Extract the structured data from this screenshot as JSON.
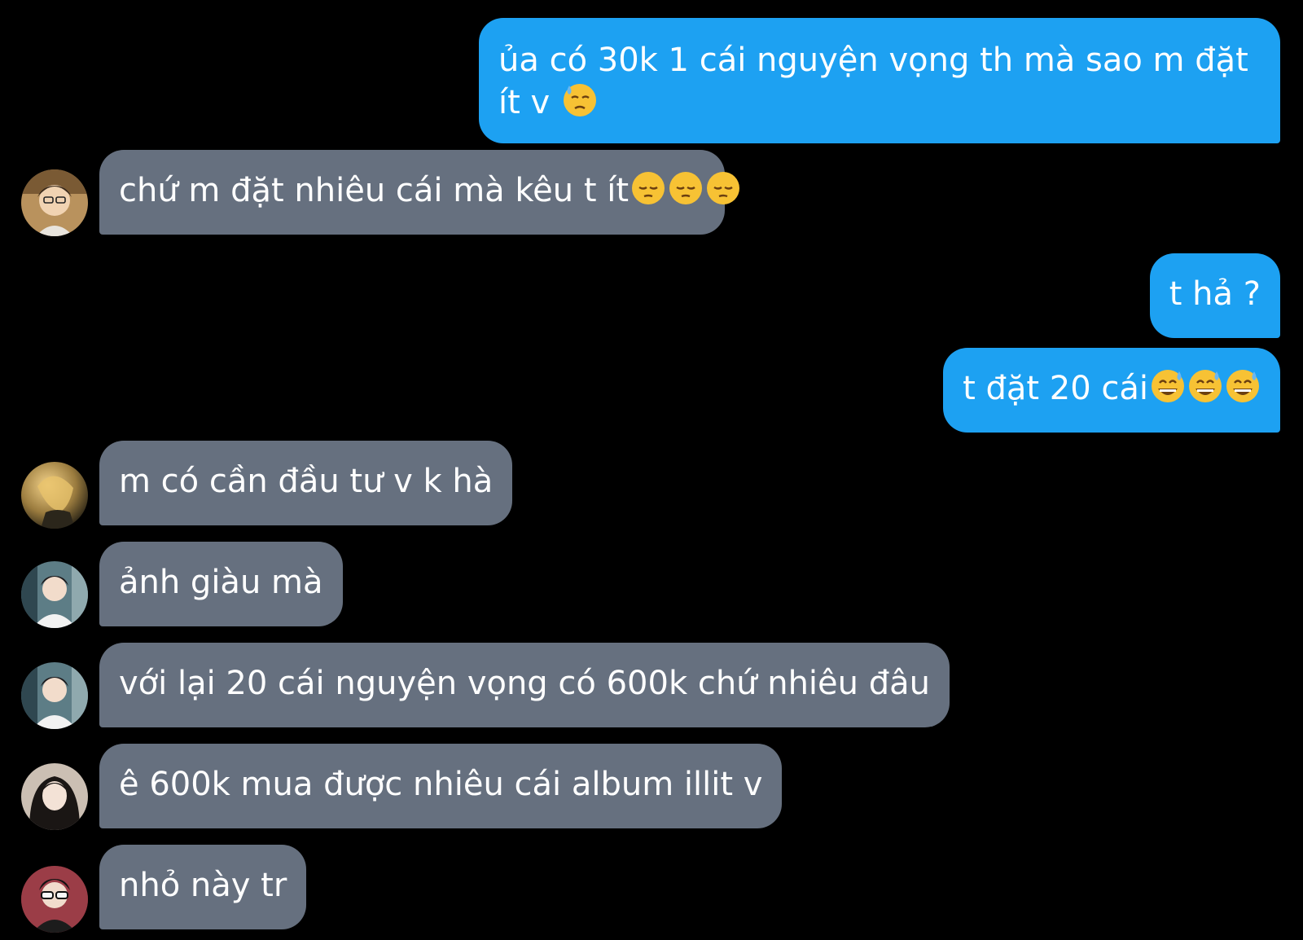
{
  "messages": [
    {
      "side": "sent",
      "text": "ủa có 30k 1 cái nguyện vọng th mà sao m đặt ít v",
      "emoji": [
        "downcast-sweat"
      ]
    },
    {
      "side": "received",
      "avatar": "avatar-1",
      "text": "chứ m đặt nhiêu cái mà kêu t ít",
      "emoji": [
        "pensive",
        "pensive",
        "pensive"
      ]
    },
    {
      "side": "sent",
      "text": "t hả ?",
      "emoji": []
    },
    {
      "side": "sent",
      "text": "t đặt 20 cái",
      "emoji": [
        "grinning-sweat",
        "grinning-sweat",
        "grinning-sweat"
      ]
    },
    {
      "side": "received",
      "avatar": "avatar-2",
      "text": "m có cần đầu tư v k hà",
      "emoji": []
    },
    {
      "side": "received",
      "avatar": "avatar-3",
      "text": "ảnh giàu mà",
      "emoji": []
    },
    {
      "side": "received",
      "avatar": "avatar-3",
      "text": "với lại 20 cái nguyện vọng có 600k chứ nhiêu đâu",
      "emoji": []
    },
    {
      "side": "received",
      "avatar": "avatar-4",
      "text": "ê 600k mua được nhiêu cái album illit v",
      "emoji": []
    },
    {
      "side": "received",
      "avatar": "avatar-5",
      "text": "nhỏ này tr",
      "emoji": []
    }
  ],
  "colors": {
    "background": "#000000",
    "sent_bubble": "#1da1f2",
    "received_bubble": "#66707f",
    "text": "#ffffff"
  }
}
